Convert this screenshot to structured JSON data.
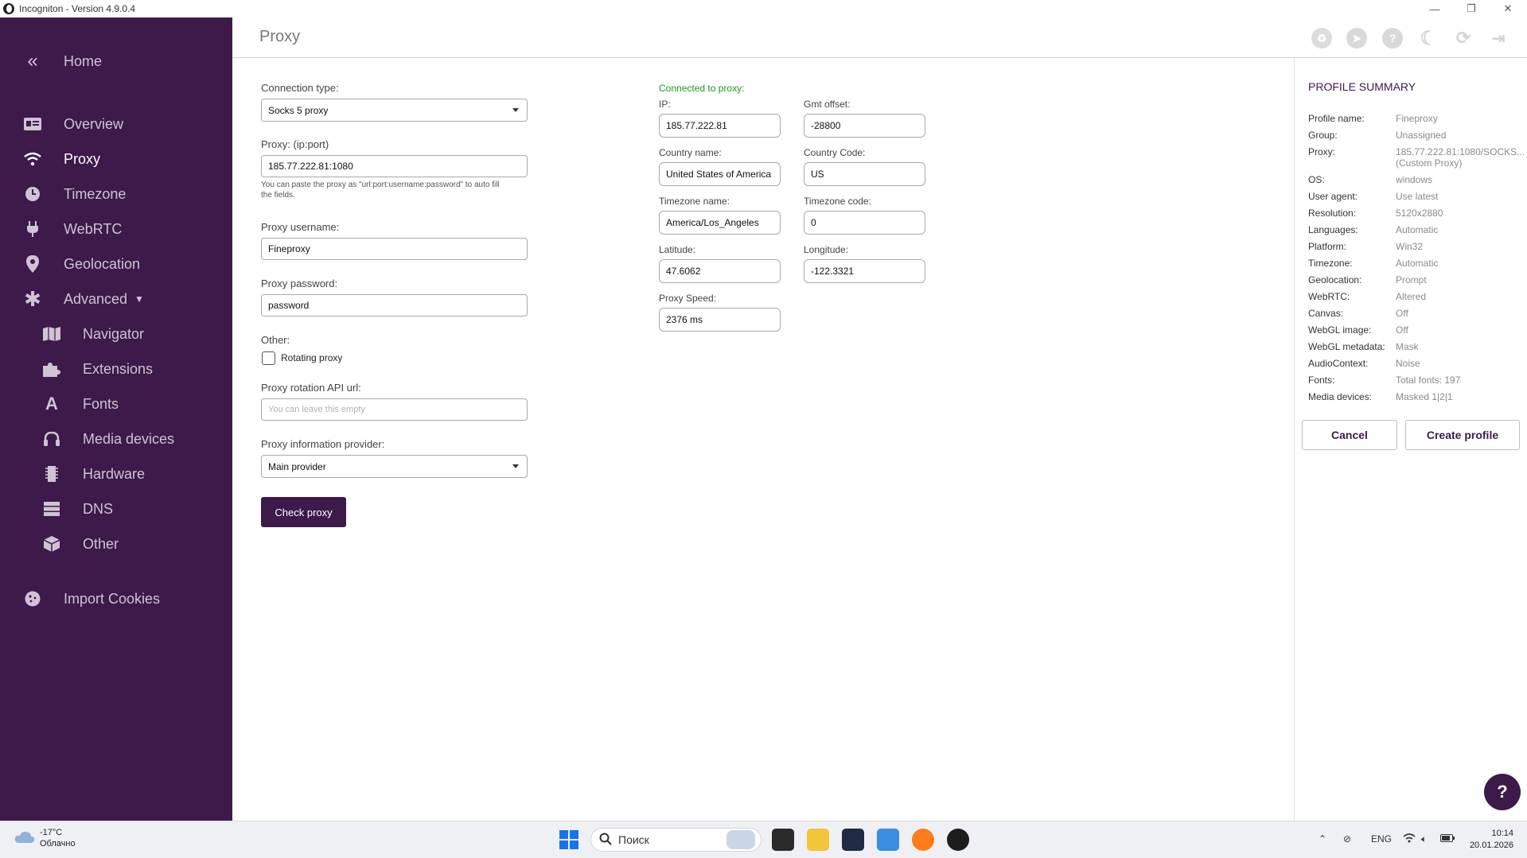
{
  "window": {
    "title": "Incogniton - Version 4.9.0.4",
    "minimize": "—",
    "maximize": "❐",
    "close": "✕"
  },
  "sidebar": {
    "collapse_icon": "«",
    "home": "Home",
    "items": [
      {
        "label": "Overview",
        "icon": "id-card-icon"
      },
      {
        "label": "Proxy",
        "icon": "wifi-icon"
      },
      {
        "label": "Timezone",
        "icon": "clock-icon"
      },
      {
        "label": "WebRTC",
        "icon": "plug-icon"
      },
      {
        "label": "Geolocation",
        "icon": "map-pin-icon"
      },
      {
        "label": "Advanced",
        "icon": "asterisk-icon"
      }
    ],
    "advanced_items": [
      {
        "label": "Navigator",
        "icon": "map-icon"
      },
      {
        "label": "Extensions",
        "icon": "puzzle-icon"
      },
      {
        "label": "Fonts",
        "icon": "font-icon"
      },
      {
        "label": "Media devices",
        "icon": "headphones-icon"
      },
      {
        "label": "Hardware",
        "icon": "chip-icon"
      },
      {
        "label": "DNS",
        "icon": "server-icon"
      },
      {
        "label": "Other",
        "icon": "box-icon"
      }
    ],
    "import_cookies": "Import Cookies"
  },
  "header": {
    "title": "Proxy"
  },
  "form": {
    "connection_type_label": "Connection type:",
    "connection_type_value": "Socks 5 proxy",
    "proxy_label": "Proxy: (ip:port)",
    "proxy_value": "185.77.222.81:1080",
    "proxy_hint_line1": "You can paste the proxy as \"url:port:username:password\" to auto fill",
    "proxy_hint_line2": "the fields.",
    "username_label": "Proxy username:",
    "username_value": "Fineproxy",
    "password_label": "Proxy password:",
    "password_value": "password",
    "other_label": "Other:",
    "rotating_label": "Rotating proxy",
    "rotation_url_label": "Proxy rotation API url:",
    "rotation_url_placeholder": "You can leave this empty",
    "provider_label": "Proxy information provider:",
    "provider_value": "Main provider",
    "check_button": "Check proxy"
  },
  "proxy_info": {
    "connected_text": "Connected to proxy:",
    "ip_label": "IP:",
    "ip_value": "185.77.222.81",
    "gmt_label": "Gmt offset:",
    "gmt_value": "-28800",
    "country_name_label": "Country name:",
    "country_name_value": "United States of America",
    "country_code_label": "Country Code:",
    "country_code_value": "US",
    "tz_name_label": "Timezone name:",
    "tz_name_value": "America/Los_Angeles",
    "tz_code_label": "Timezone code:",
    "tz_code_value": "0",
    "lat_label": "Latitude:",
    "lat_value": "47.6062",
    "lon_label": "Longitude:",
    "lon_value": "-122.3321",
    "speed_label": "Proxy Speed:",
    "speed_value": "2376 ms"
  },
  "summary": {
    "title": "PROFILE SUMMARY",
    "rows": [
      {
        "key": "Profile name:",
        "value": "Fineproxy"
      },
      {
        "key": "Group:",
        "value": "Unassigned"
      },
      {
        "key": "Proxy:",
        "value": "185.77.222.81:1080/SOCKS...",
        "value2": "(Custom Proxy)"
      },
      {
        "key": "OS:",
        "value": "windows"
      },
      {
        "key": "User agent:",
        "value": "Use latest"
      },
      {
        "key": "Resolution:",
        "value": "5120x2880"
      },
      {
        "key": "Languages:",
        "value": "Automatic"
      },
      {
        "key": "Platform:",
        "value": "Win32"
      },
      {
        "key": "Timezone:",
        "value": "Automatic"
      },
      {
        "key": "Geolocation:",
        "value": "Prompt"
      },
      {
        "key": "WebRTC:",
        "value": "Altered"
      },
      {
        "key": "Canvas:",
        "value": "Off"
      },
      {
        "key": "WebGL image:",
        "value": "Off"
      },
      {
        "key": "WebGL metadata:",
        "value": "Mask"
      },
      {
        "key": "AudioContext:",
        "value": "Noise"
      },
      {
        "key": "Fonts:",
        "value": "Total fonts: 197"
      },
      {
        "key": "Media devices:",
        "value": "Masked 1|2|1"
      }
    ],
    "cancel": "Cancel",
    "create": "Create profile"
  },
  "help_fab": "?",
  "taskbar": {
    "weather_temp": "-17°C",
    "weather_desc": "Облачно",
    "search_placeholder": "Поиск",
    "lang": "ENG",
    "time": "10:14",
    "date": "20.01.2026"
  }
}
